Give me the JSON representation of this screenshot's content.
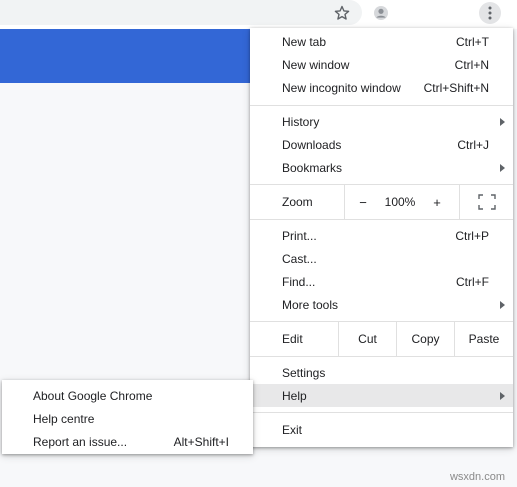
{
  "menu": {
    "items": {
      "new_tab": {
        "label": "New tab",
        "shortcut": "Ctrl+T"
      },
      "new_window": {
        "label": "New window",
        "shortcut": "Ctrl+N"
      },
      "new_incognito": {
        "label": "New incognito window",
        "shortcut": "Ctrl+Shift+N"
      },
      "history": {
        "label": "History"
      },
      "downloads": {
        "label": "Downloads",
        "shortcut": "Ctrl+J"
      },
      "bookmarks": {
        "label": "Bookmarks"
      },
      "print": {
        "label": "Print...",
        "shortcut": "Ctrl+P"
      },
      "cast": {
        "label": "Cast..."
      },
      "find": {
        "label": "Find...",
        "shortcut": "Ctrl+F"
      },
      "more_tools": {
        "label": "More tools"
      },
      "settings": {
        "label": "Settings"
      },
      "help": {
        "label": "Help"
      },
      "exit": {
        "label": "Exit"
      }
    },
    "zoom": {
      "label": "Zoom",
      "minus": "−",
      "level": "100%",
      "plus": "+"
    },
    "edit": {
      "label": "Edit",
      "cut": "Cut",
      "copy": "Copy",
      "paste": "Paste"
    }
  },
  "help_submenu": {
    "about": {
      "label": "About Google Chrome"
    },
    "help_centre": {
      "label": "Help centre"
    },
    "report": {
      "label": "Report an issue...",
      "shortcut": "Alt+Shift+I"
    }
  },
  "icons": [
    "star-icon",
    "profile-icon",
    "kebab-menu-icon",
    "fullscreen-icon",
    "submenu-arrow-icon"
  ],
  "colors": {
    "page_header_blue": "#3367d6",
    "highlight": "#e8e8e9"
  },
  "watermark": "wsxdn.com"
}
